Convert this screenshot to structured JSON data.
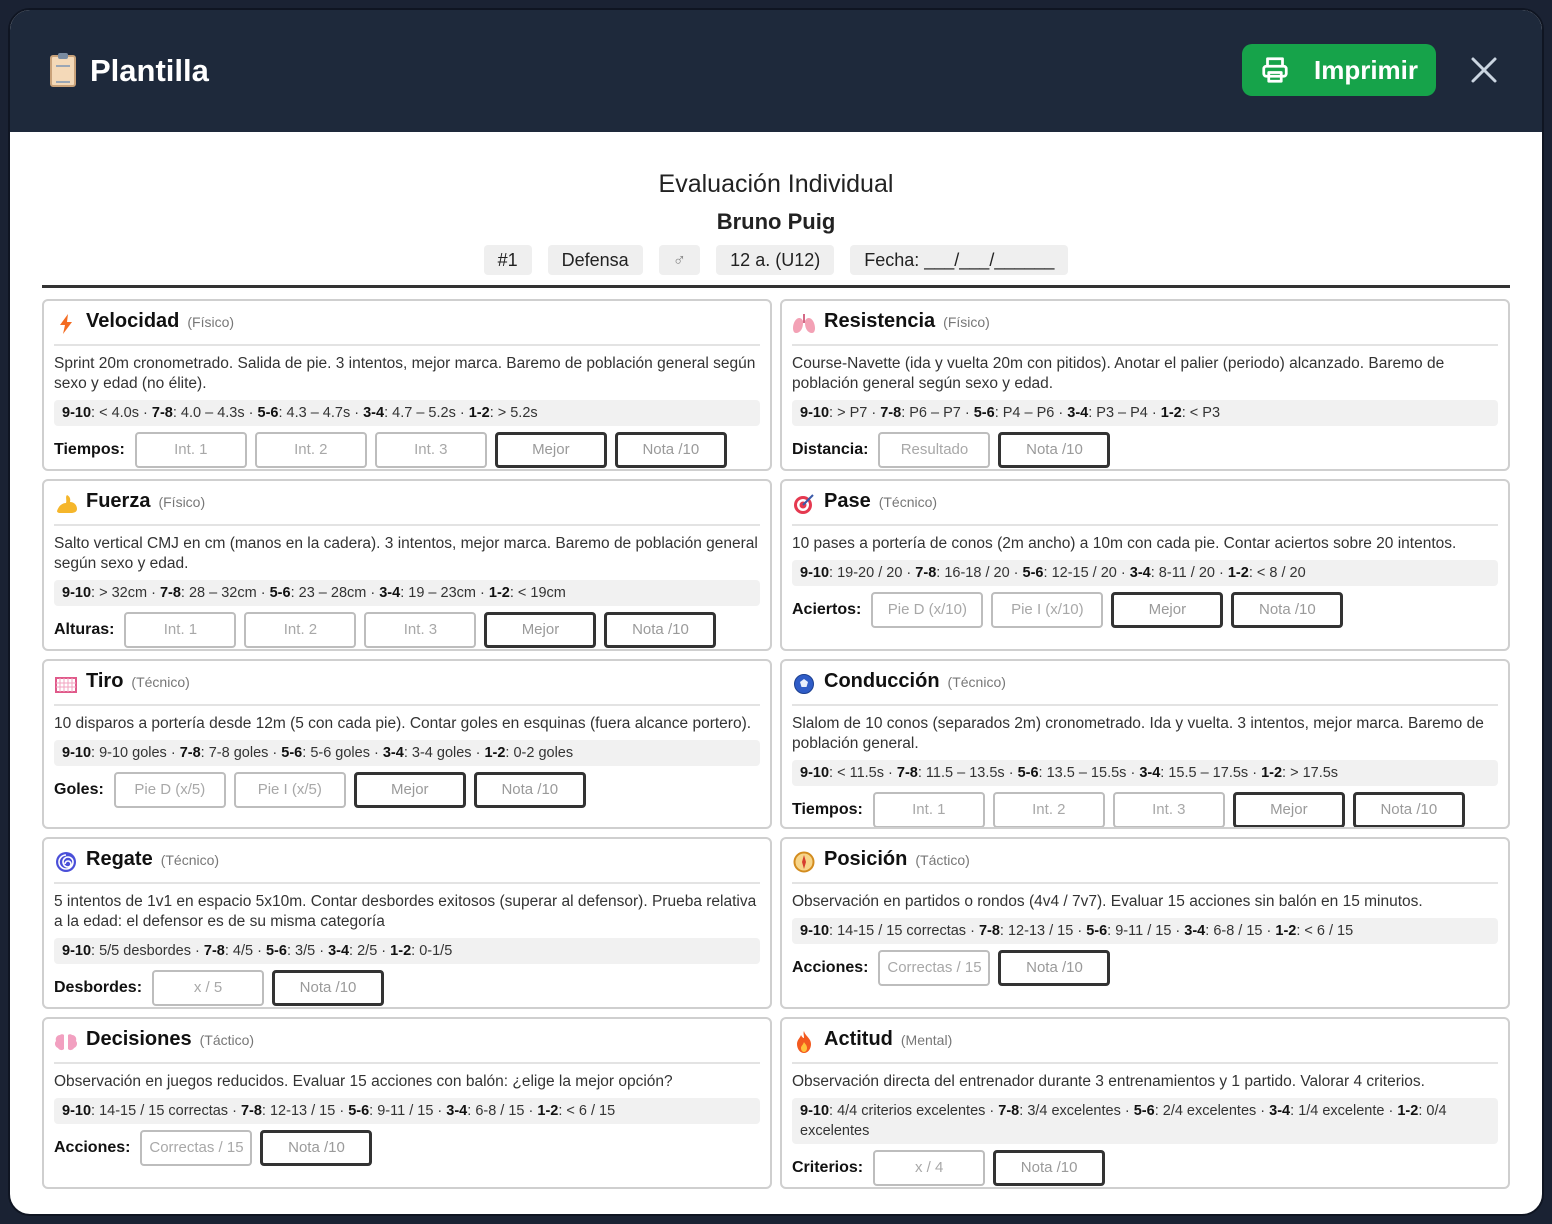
{
  "header": {
    "title": "Plantilla",
    "print_label": "Imprimir"
  },
  "evaluation": {
    "title": "Evaluación Individual",
    "player": "Bruno Puig",
    "chips": {
      "number": "#1",
      "position": "Defensa",
      "gender": "♂",
      "age": "12 a. (U12)",
      "date": "Fecha: ___/___/______"
    }
  },
  "cards": [
    {
      "title": "Velocidad",
      "category": "(Físico)",
      "icon": "lightning-icon",
      "desc": "Sprint 20m cronometrado. Salida de pie. 3 intentos, mejor marca. Baremo de población general según sexo y edad (no élite).",
      "scale": [
        [
          "9-10",
          "< 4.0s"
        ],
        [
          "7-8",
          "4.0 – 4.3s"
        ],
        [
          "5-6",
          "4.3 – 4.7s"
        ],
        [
          "3-4",
          "4.7 – 5.2s"
        ],
        [
          "1-2",
          "> 5.2s"
        ]
      ],
      "input_label": "Tiempos:",
      "fields": [
        [
          "Int. 1",
          false
        ],
        [
          "Int. 2",
          false
        ],
        [
          "Int. 3",
          false
        ],
        [
          "Mejor",
          true
        ],
        [
          "Nota /10",
          true
        ]
      ]
    },
    {
      "title": "Resistencia",
      "category": "(Físico)",
      "icon": "lungs-icon",
      "desc": "Course-Navette (ida y vuelta 20m con pitidos). Anotar el palier (periodo) alcanzado. Baremo de población general según sexo y edad.",
      "scale": [
        [
          "9-10",
          "> P7"
        ],
        [
          "7-8",
          "P6 – P7"
        ],
        [
          "5-6",
          "P4 – P6"
        ],
        [
          "3-4",
          "P3 – P4"
        ],
        [
          "1-2",
          "< P3"
        ]
      ],
      "input_label": "Distancia:",
      "fields": [
        [
          "Resultado",
          false
        ],
        [
          "Nota /10",
          true
        ]
      ]
    },
    {
      "title": "Fuerza",
      "category": "(Físico)",
      "icon": "flexed-arm-icon",
      "desc": "Salto vertical CMJ en cm (manos en la cadera). 3 intentos, mejor marca. Baremo de población general según sexo y edad.",
      "scale": [
        [
          "9-10",
          "> 32cm"
        ],
        [
          "7-8",
          "28 – 32cm"
        ],
        [
          "5-6",
          "23 – 28cm"
        ],
        [
          "3-4",
          "19 – 23cm"
        ],
        [
          "1-2",
          "< 19cm"
        ]
      ],
      "input_label": "Alturas:",
      "fields": [
        [
          "Int. 1",
          false
        ],
        [
          "Int. 2",
          false
        ],
        [
          "Int. 3",
          false
        ],
        [
          "Mejor",
          true
        ],
        [
          "Nota /10",
          true
        ]
      ]
    },
    {
      "title": "Pase",
      "category": "(Técnico)",
      "icon": "target-icon",
      "desc": "10 pases a portería de conos (2m ancho) a 10m con cada pie. Contar aciertos sobre 20 intentos.",
      "scale": [
        [
          "9-10",
          "19-20 / 20"
        ],
        [
          "7-8",
          "16-18 / 20"
        ],
        [
          "5-6",
          "12-15 / 20"
        ],
        [
          "3-4",
          "8-11 / 20"
        ],
        [
          "1-2",
          "< 8 / 20"
        ]
      ],
      "input_label": "Aciertos:",
      "fields": [
        [
          "Pie D (x/10)",
          false
        ],
        [
          "Pie I (x/10)",
          false
        ],
        [
          "Mejor",
          true
        ],
        [
          "Nota /10",
          true
        ]
      ]
    },
    {
      "title": "Tiro",
      "category": "(Técnico)",
      "icon": "goal-net-icon",
      "desc": "10 disparos a portería desde 12m (5 con cada pie). Contar goles en esquinas (fuera alcance portero).",
      "scale": [
        [
          "9-10",
          "9-10 goles"
        ],
        [
          "7-8",
          "7-8 goles"
        ],
        [
          "5-6",
          "5-6 goles"
        ],
        [
          "3-4",
          "3-4 goles"
        ],
        [
          "1-2",
          "0-2 goles"
        ]
      ],
      "input_label": "Goles:",
      "fields": [
        [
          "Pie D (x/5)",
          false
        ],
        [
          "Pie I (x/5)",
          false
        ],
        [
          "Mejor",
          true
        ],
        [
          "Nota /10",
          true
        ]
      ]
    },
    {
      "title": "Conducción",
      "category": "(Técnico)",
      "icon": "soccer-ball-icon",
      "desc": "Slalom de 10 conos (separados 2m) cronometrado. Ida y vuelta. 3 intentos, mejor marca. Baremo de población general.",
      "scale": [
        [
          "9-10",
          "< 11.5s"
        ],
        [
          "7-8",
          "11.5 – 13.5s"
        ],
        [
          "5-6",
          "13.5 – 15.5s"
        ],
        [
          "3-4",
          "15.5 – 17.5s"
        ],
        [
          "1-2",
          "> 17.5s"
        ]
      ],
      "input_label": "Tiempos:",
      "fields": [
        [
          "Int. 1",
          false
        ],
        [
          "Int. 2",
          false
        ],
        [
          "Int. 3",
          false
        ],
        [
          "Mejor",
          true
        ],
        [
          "Nota /10",
          true
        ]
      ]
    },
    {
      "title": "Regate",
      "category": "(Técnico)",
      "icon": "cyclone-icon",
      "desc": "5 intentos de 1v1 en espacio 5x10m. Contar desbordes exitosos (superar al defensor). Prueba relativa a la edad: el defensor es de su misma categoría",
      "scale": [
        [
          "9-10",
          "5/5 desbordes"
        ],
        [
          "7-8",
          "4/5"
        ],
        [
          "5-6",
          "3/5"
        ],
        [
          "3-4",
          "2/5"
        ],
        [
          "1-2",
          "0-1/5"
        ]
      ],
      "input_label": "Desbordes:",
      "fields": [
        [
          "x / 5",
          false
        ],
        [
          "Nota /10",
          true
        ]
      ]
    },
    {
      "title": "Posición",
      "category": "(Táctico)",
      "icon": "compass-icon",
      "desc": "Observación en partidos o rondos (4v4 / 7v7). Evaluar 15 acciones sin balón en 15 minutos.",
      "scale": [
        [
          "9-10",
          "14-15 / 15 correctas"
        ],
        [
          "7-8",
          "12-13 / 15"
        ],
        [
          "5-6",
          "9-11 / 15"
        ],
        [
          "3-4",
          "6-8 / 15"
        ],
        [
          "1-2",
          "< 6 / 15"
        ]
      ],
      "input_label": "Acciones:",
      "fields": [
        [
          "Correctas / 15",
          false
        ],
        [
          "Nota /10",
          true
        ]
      ]
    },
    {
      "title": "Decisiones",
      "category": "(Táctico)",
      "icon": "brain-icon",
      "desc": "Observación en juegos reducidos. Evaluar 15 acciones con balón: ¿elige la mejor opción?",
      "scale": [
        [
          "9-10",
          "14-15 / 15 correctas"
        ],
        [
          "7-8",
          "12-13 / 15"
        ],
        [
          "5-6",
          "9-11 / 15"
        ],
        [
          "3-4",
          "6-8 / 15"
        ],
        [
          "1-2",
          "< 6 / 15"
        ]
      ],
      "input_label": "Acciones:",
      "fields": [
        [
          "Correctas / 15",
          false
        ],
        [
          "Nota /10",
          true
        ]
      ]
    },
    {
      "title": "Actitud",
      "category": "(Mental)",
      "icon": "fire-icon",
      "desc": "Observación directa del entrenador durante 3 entrenamientos y 1 partido. Valorar 4 criterios.",
      "scale": [
        [
          "9-10",
          "4/4 criterios excelentes"
        ],
        [
          "7-8",
          "3/4 excelentes"
        ],
        [
          "5-6",
          "2/4 excelentes"
        ],
        [
          "3-4",
          "1/4 excelente"
        ],
        [
          "1-2",
          "0/4 excelentes"
        ]
      ],
      "input_label": "Criterios:",
      "fields": [
        [
          "x / 4",
          false
        ],
        [
          "Nota /10",
          true
        ]
      ]
    }
  ]
}
